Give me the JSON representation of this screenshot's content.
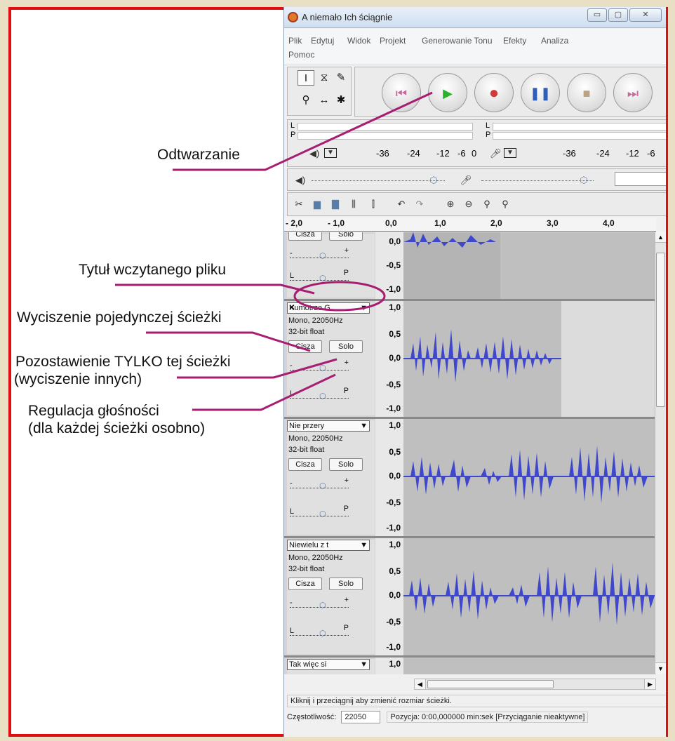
{
  "window": {
    "title": "A niemało Ich ściągnie",
    "buttons": [
      "▭",
      "▢",
      "✕"
    ]
  },
  "menu": [
    "Plik",
    "Edytuj",
    "Widok",
    "Projekt",
    "Generowanie Tonu",
    "Efekty",
    "Analiza",
    "Pomoc"
  ],
  "annotations": {
    "playback": "Odtwarzanie",
    "file_title": "Tytuł wczytanego pliku",
    "mute_track": "Wyciszenie pojedynczej ścieżki",
    "solo_line1": "Pozostawienie TYLKO tej ścieżki",
    "solo_line2": "(wyciszenie innych)",
    "volume_line1": "Regulacja głośności",
    "volume_line2": "(dla każdej ścieżki osobno)"
  },
  "meters": {
    "L": "L",
    "P": "P",
    "playback_scale": [
      "-36",
      "-24",
      "-12",
      "-6",
      "0"
    ],
    "record_scale": [
      "-36",
      "-24",
      "-12",
      "-6"
    ]
  },
  "ruler": [
    "- 2,0",
    "- 1,0",
    "0,0",
    "1,0",
    "2,0",
    "3,0",
    "4,0"
  ],
  "vscale": {
    "top": "1,0",
    "half": "0,5",
    "zero": "0,0",
    "neg_half": "-0,5",
    "bottom": "-1,0"
  },
  "first_track": {
    "mute": "Cisza",
    "solo": "Solo",
    "scale": [
      "0,0",
      "-0,5",
      "-1,0"
    ]
  },
  "tracks": [
    {
      "name": "Kumotrze G",
      "format": "Mono, 22050Hz",
      "bits": "32-bit float",
      "mute": "Cisza",
      "solo": "Solo"
    },
    {
      "name": "Nie przery",
      "format": "Mono, 22050Hz",
      "bits": "32-bit float",
      "mute": "Cisza",
      "solo": "Solo"
    },
    {
      "name": "Niewielu z t",
      "format": "Mono, 22050Hz",
      "bits": "32-bit float",
      "mute": "Cisza",
      "solo": "Solo"
    },
    {
      "name": "Tak więc si",
      "scale_top": "1,0"
    }
  ],
  "slider_labels": {
    "minus": "-",
    "plus": "+",
    "left": "L",
    "right": "P"
  },
  "status": {
    "hint": "Kliknij i przeciągnij aby zmienić rozmiar ścieżki.",
    "rate_label": "Częstotliwość:",
    "rate_value": "22050",
    "position": "Pozycja: 0:00,000000 min:sek",
    "snap": "[Przyciąganie nieaktywne]"
  },
  "colors": {
    "frame": "#e20d12",
    "leader": "#a71d72",
    "wave": "#3f48cc",
    "play": "#2bb22b",
    "record": "#d23a3a",
    "pause": "#2f5fb8",
    "stop": "#b9a382"
  }
}
